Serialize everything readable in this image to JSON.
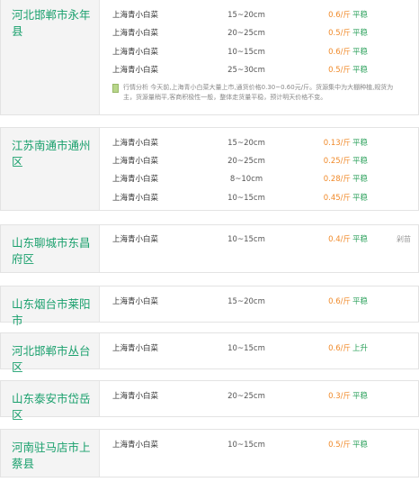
{
  "blocks": [
    {
      "region": "河北邯郸市永年县",
      "rows": [
        {
          "name": "上海青小白菜",
          "size": "15~20cm",
          "price": "0.6/斤",
          "trend": "平稳"
        },
        {
          "name": "上海青小白菜",
          "size": "20~25cm",
          "price": "0.5/斤",
          "trend": "平稳"
        },
        {
          "name": "上海青小白菜",
          "size": "10~15cm",
          "price": "0.6/斤",
          "trend": "平稳"
        },
        {
          "name": "上海青小白菜",
          "size": "25~30cm",
          "price": "0.5/斤",
          "trend": "平稳"
        }
      ],
      "analysis": "行情分析 今天前,上海青小白菜大量上市,通货价格0.30~0.60元/斤。货源集中为大棚种植,规货为主，货源量稍平,客商积极性一般，整体走货量平稳，预计明天价格不变。"
    },
    {
      "region": "江苏南通市通州区",
      "rows": [
        {
          "name": "上海青小白菜",
          "size": "15~20cm",
          "price": "0.13/斤",
          "trend": "平稳"
        },
        {
          "name": "上海青小白菜",
          "size": "20~25cm",
          "price": "0.25/斤",
          "trend": "平稳"
        },
        {
          "name": "上海青小白菜",
          "size": "8~10cm",
          "price": "0.28/斤",
          "trend": "平稳"
        },
        {
          "name": "上海青小白菜",
          "size": "10~15cm",
          "price": "0.45/斤",
          "trend": "平稳"
        }
      ]
    },
    {
      "region": "山东聊城市东昌府区",
      "rows": [
        {
          "name": "上海青小白菜",
          "size": "10~15cm",
          "price": "0.4/斤",
          "trend": "平稳",
          "extra": "剁苗"
        }
      ]
    },
    {
      "region": "山东烟台市莱阳市",
      "rows": [
        {
          "name": "上海青小白菜",
          "size": "15~20cm",
          "price": "0.6/斤",
          "trend": "平稳"
        }
      ]
    },
    {
      "region": "河北邯郸市丛台区",
      "rows": [
        {
          "name": "上海青小白菜",
          "size": "10~15cm",
          "price": "0.6/斤",
          "trend": "上升"
        }
      ]
    },
    {
      "region": "山东泰安市岱岳区",
      "rows": [
        {
          "name": "上海青小白菜",
          "size": "20~25cm",
          "price": "0.3/斤",
          "trend": "平稳"
        }
      ]
    },
    {
      "region": "河南驻马店市上蔡县",
      "rows": [
        {
          "name": "上海青小白菜",
          "size": "10~15cm",
          "price": "0.5/斤",
          "trend": "平稳"
        }
      ]
    }
  ],
  "colors": {
    "region": "#1aa06d",
    "price": "#f08a2a",
    "trend": "#2aa05a"
  }
}
